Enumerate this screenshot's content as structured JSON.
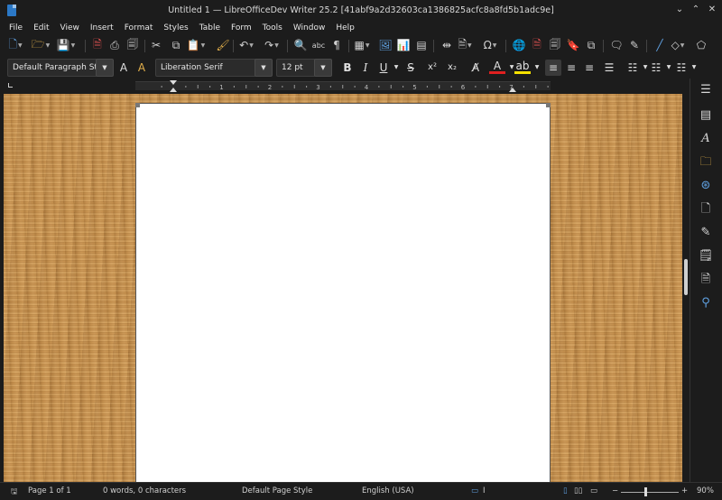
{
  "window": {
    "title": "Untitled 1 — LibreOfficeDev Writer 25.2 [41abf9a2d32603ca1386825acfc8a8fd5b1adc9e]"
  },
  "menu": [
    "File",
    "Edit",
    "View",
    "Insert",
    "Format",
    "Styles",
    "Table",
    "Form",
    "Tools",
    "Window",
    "Help"
  ],
  "formatting": {
    "paragraph_style": "Default Paragraph Styl",
    "font_name": "Liberation Serif",
    "font_size": "12 pt"
  },
  "ruler": {
    "labels": [
      "1",
      "2",
      "3",
      "4",
      "5",
      "6",
      "7"
    ]
  },
  "status": {
    "page": "Page 1 of 1",
    "words": "0 words, 0 characters",
    "page_style": "Default Page Style",
    "language": "English (USA)",
    "zoom": "90%"
  },
  "colors": {
    "accent": "#2b78c6",
    "font_color": "#e02020",
    "highlight": "#f5e100",
    "background": "#c99552"
  }
}
